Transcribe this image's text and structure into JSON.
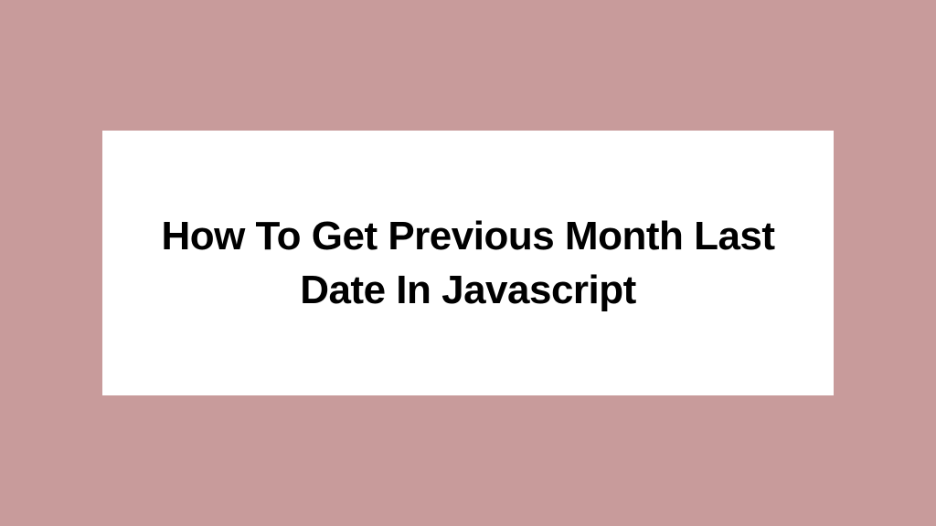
{
  "card": {
    "title": "How To Get Previous Month Last Date In Javascript"
  },
  "colors": {
    "background": "#c89b9b",
    "card": "#ffffff",
    "text": "#000000"
  }
}
